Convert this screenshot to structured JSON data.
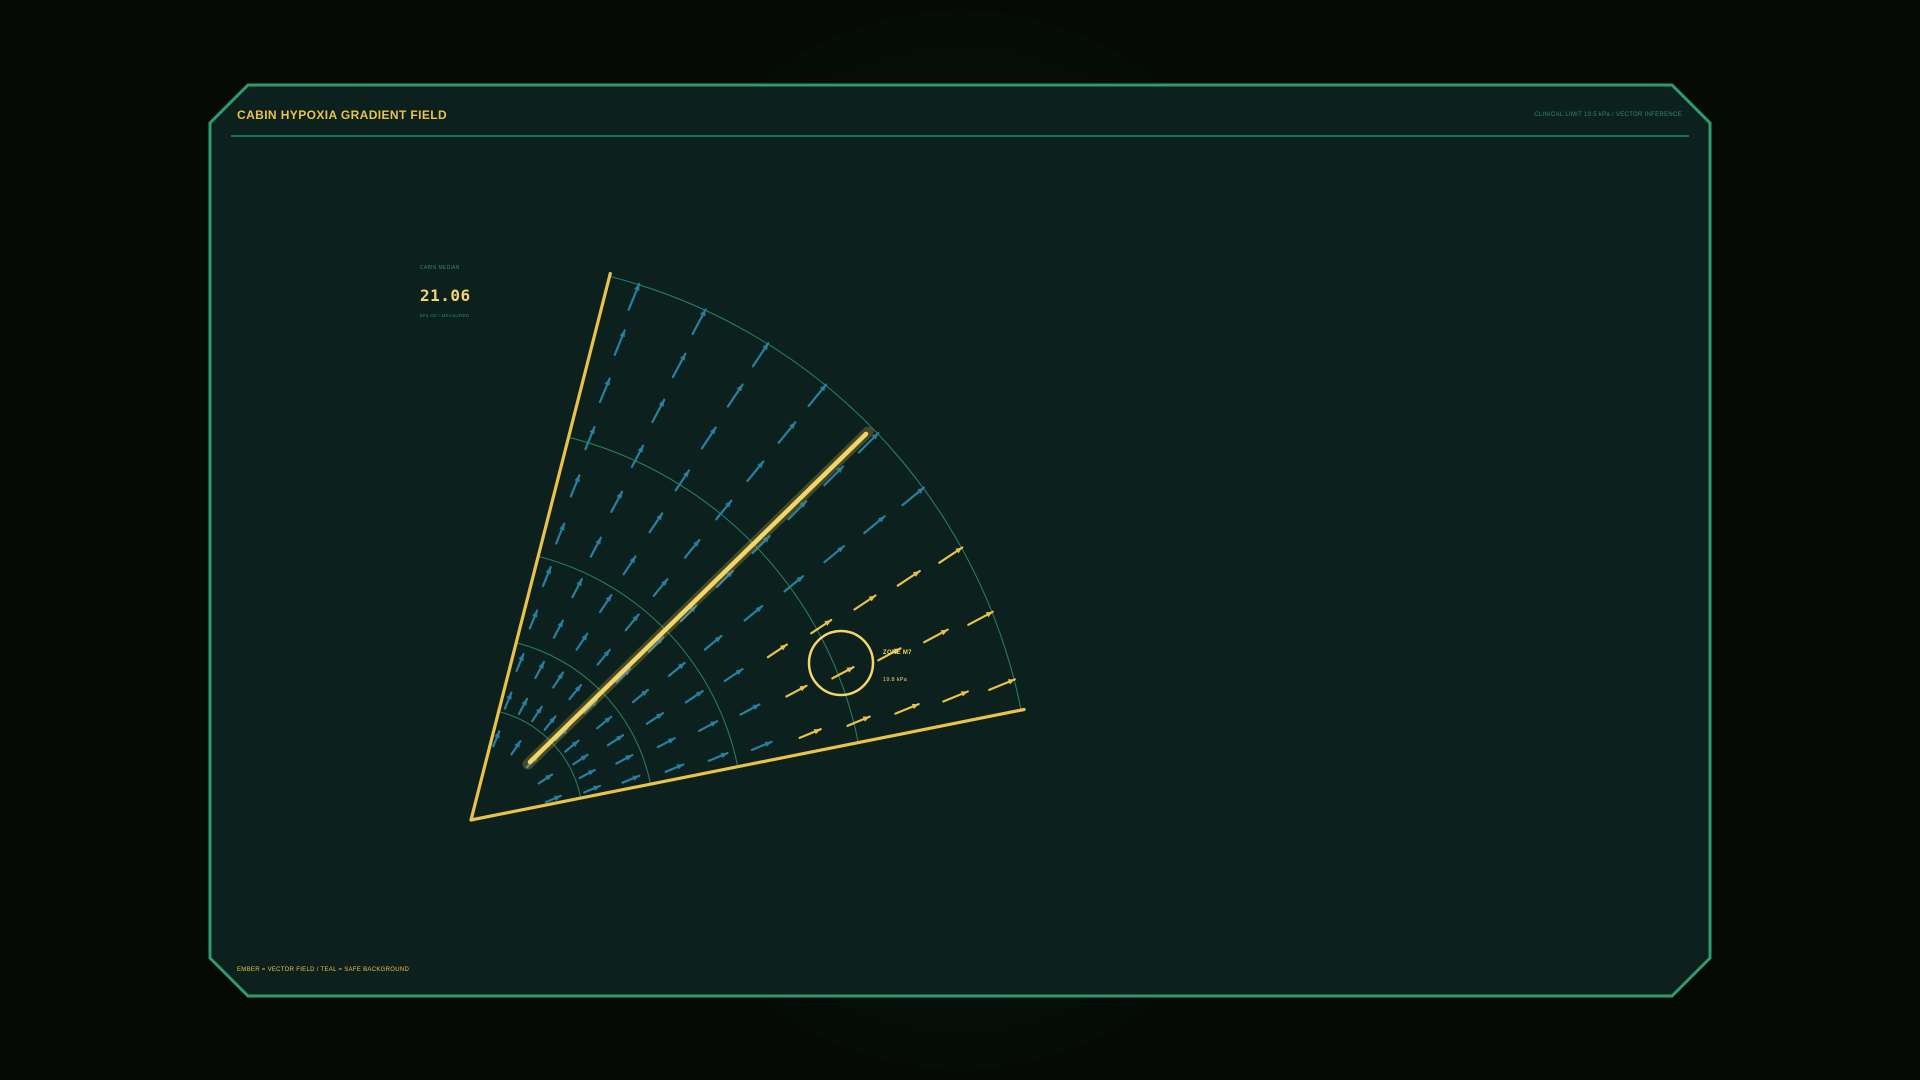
{
  "header": {
    "title": "CABIN HYPOXIA GRADIENT FIELD",
    "subtitle": "CLINICAL LIMIT 19.5 kPa / VECTOR INFERENCE"
  },
  "readout": {
    "label": "CABIN MEDIAN",
    "value": "21.06",
    "sub": "kPa O2 / MEASURED"
  },
  "zone": {
    "label": "ZONE M7",
    "value": "19.8 kPa"
  },
  "legend": {
    "text": "EMBER = VECTOR FIELD  /  TEAL = SAFE BACKGROUND"
  },
  "colors": {
    "background": "#050a05",
    "panel": "#0c201d",
    "frame": "#2f9a72",
    "accent": "#e9c24c",
    "accent_bright": "#f3d56a",
    "vector_safe": "#2a7fa0",
    "vector_alert": "#e9c24c",
    "grid": "#2f8a6a"
  },
  "icons": {
    "zone_marker": "ring-marker-icon",
    "gradient_axis": "gradient-axis-line"
  }
}
